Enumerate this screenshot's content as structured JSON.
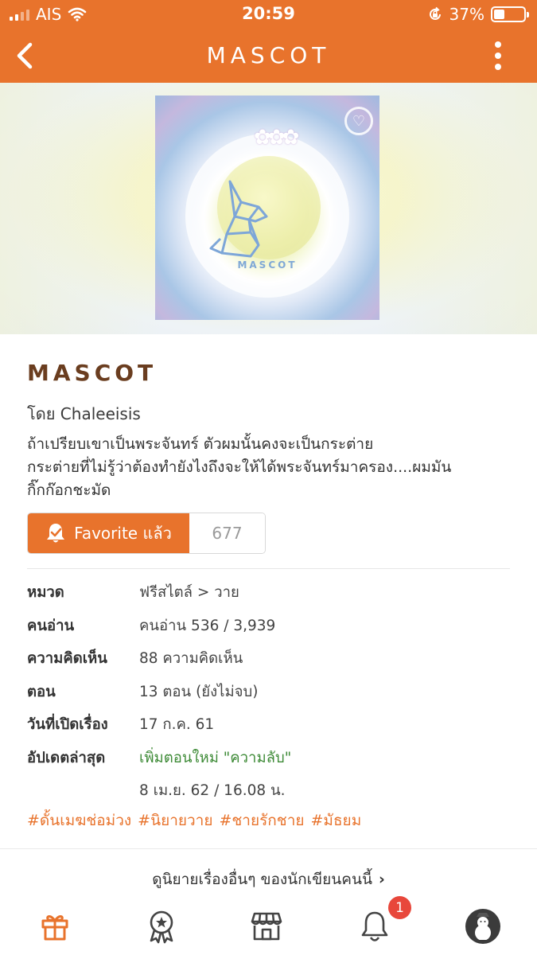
{
  "status_bar": {
    "carrier": "AIS",
    "time": "20:59",
    "battery_percent": "37%",
    "battery_level": 0.37
  },
  "header": {
    "title": "MASCOT"
  },
  "cover": {
    "caption": "MASCOT"
  },
  "story": {
    "title": "MASCOT",
    "author": "โดย Chaleeisis",
    "description": "ถ้าเปรียบเขาเป็นพระจันทร์ ตัวผมนั้นคงจะเป็นกระต่าย\nกระต่ายที่ไม่รู้ว่าต้องทำยังไงถึงจะให้ได้พระจันทร์มาครอง....ผมมัน\nกิ๊กก๊อกชะมัด"
  },
  "favorite": {
    "label": "Favorite แล้ว",
    "count": "677"
  },
  "info": [
    {
      "label": "หมวด",
      "value": "ฟรีสไตล์ > วาย"
    },
    {
      "label": "คนอ่าน",
      "value": "คนอ่าน 536 / 3,939"
    },
    {
      "label": "ความคิดเห็น",
      "value": "88 ความคิดเห็น"
    },
    {
      "label": "ตอน",
      "value": "13 ตอน (ยังไม่จบ)"
    },
    {
      "label": "วันที่เปิดเรื่อง",
      "value": "17 ก.ค. 61"
    }
  ],
  "update": {
    "label": "อัปเดตล่าสุด",
    "link": "เพิ่มตอนใหม่ \"ความลับ\"",
    "datetime": "8 เม.ย. 62 / 16.08 น."
  },
  "tags": [
    "#ดั้นเมฆช่อม่วง",
    "#นิยายวาย",
    "#ชายรักชาย",
    "#มัธยม"
  ],
  "more_link": "ดูนิยายเรื่องอื่นๆ ของนักเขียนคนนี้",
  "tabbar": {
    "notification_badge": "1"
  },
  "colors": {
    "brand": "#e8732c",
    "title": "#6a3d1f",
    "link_green": "#3d8a36",
    "badge": "#e8473b"
  },
  "icons": [
    "wifi-icon",
    "lock-rotation-icon",
    "back-icon",
    "more-vertical-icon",
    "favorite-bookmark-icon",
    "gift-icon",
    "award-icon",
    "store-icon",
    "bell-icon",
    "chevron-right-icon"
  ]
}
